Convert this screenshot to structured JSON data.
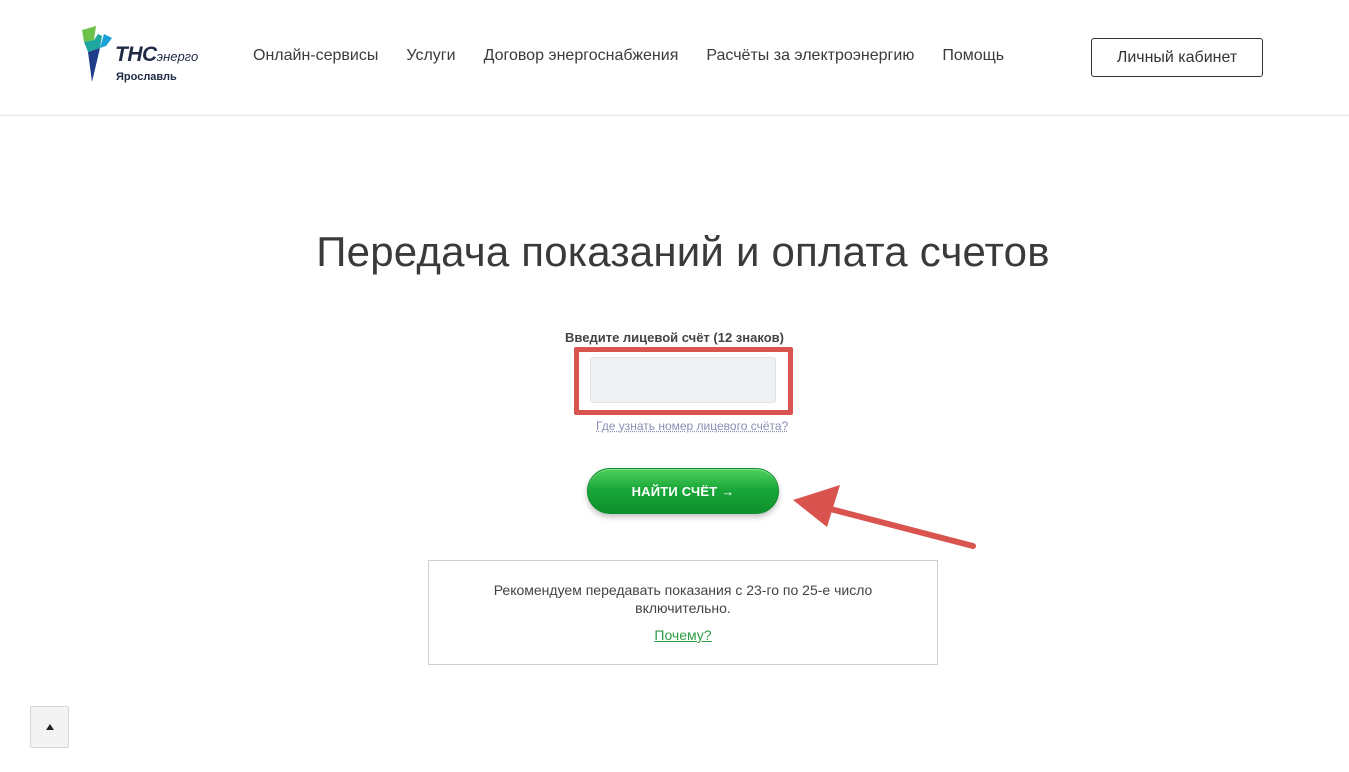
{
  "header": {
    "logo_brand": "ТНС",
    "logo_brand_sub": "энерго",
    "logo_city": "Ярославль",
    "nav": [
      {
        "label": "Онлайн-сервисы"
      },
      {
        "label": "Услуги"
      },
      {
        "label": "Договор энергоснабжения"
      },
      {
        "label": "Расчёты за электроэнергию"
      },
      {
        "label": "Помощь"
      }
    ],
    "cabinet_label": "Личный кабинет"
  },
  "main": {
    "title": "Передача показаний и оплата счетов",
    "account_label": "Введите лицевой счёт (12 знаков)",
    "account_value": "",
    "account_placeholder": "",
    "help_link": "Где узнать номер лицевого счёта?",
    "find_button": "НАЙТИ СЧЁТ →",
    "info_text": "Рекомендуем передавать показания с 23-го по 25-е число включительно.",
    "why_link": "Почему?"
  },
  "icons": {
    "scroll_top": "arrow-up-icon",
    "annotation_arrow": "red-arrow-icon"
  },
  "colors": {
    "accent_green": "#1aa83a",
    "annotation_red": "#d9534f",
    "link_green": "#2e9d45"
  }
}
